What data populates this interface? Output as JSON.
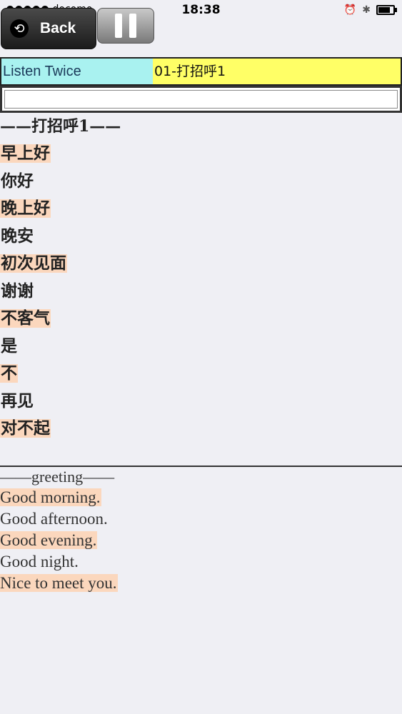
{
  "status": {
    "carrier": "●●●●● docomo",
    "time": "18:38",
    "battery_level": 0.8
  },
  "toolbar": {
    "back_label": "Back",
    "icons": {
      "back": "back-circle-icon",
      "pause": "pause-icon"
    }
  },
  "mode": {
    "label": "Listen Twice",
    "lesson": "01-打招呼1"
  },
  "input": {
    "value": ""
  },
  "chinese": {
    "header": "——打招呼1——",
    "items": [
      {
        "text": "早上好",
        "highlight": true
      },
      {
        "text": "你好",
        "highlight": false
      },
      {
        "text": "晚上好",
        "highlight": true
      },
      {
        "text": "晚安",
        "highlight": false
      },
      {
        "text": "初次见面",
        "highlight": true
      },
      {
        "text": "谢谢",
        "highlight": false
      },
      {
        "text": "不客气",
        "highlight": true
      },
      {
        "text": "是",
        "highlight": false
      },
      {
        "text": "不",
        "highlight": true
      },
      {
        "text": "再见",
        "highlight": false
      },
      {
        "text": "对不起",
        "highlight": true
      }
    ]
  },
  "english": {
    "header": "——greeting——",
    "items": [
      {
        "text": "Good morning.",
        "highlight": true
      },
      {
        "text": "Good afternoon.",
        "highlight": false
      },
      {
        "text": "Good evening.",
        "highlight": true
      },
      {
        "text": "Good night.",
        "highlight": false
      },
      {
        "text": "Nice to meet you.",
        "highlight": true
      }
    ]
  },
  "colors": {
    "mode_left_bg": "#a9f2f0",
    "mode_right_bg": "#ffff66",
    "highlight": "#fbd7bd"
  }
}
